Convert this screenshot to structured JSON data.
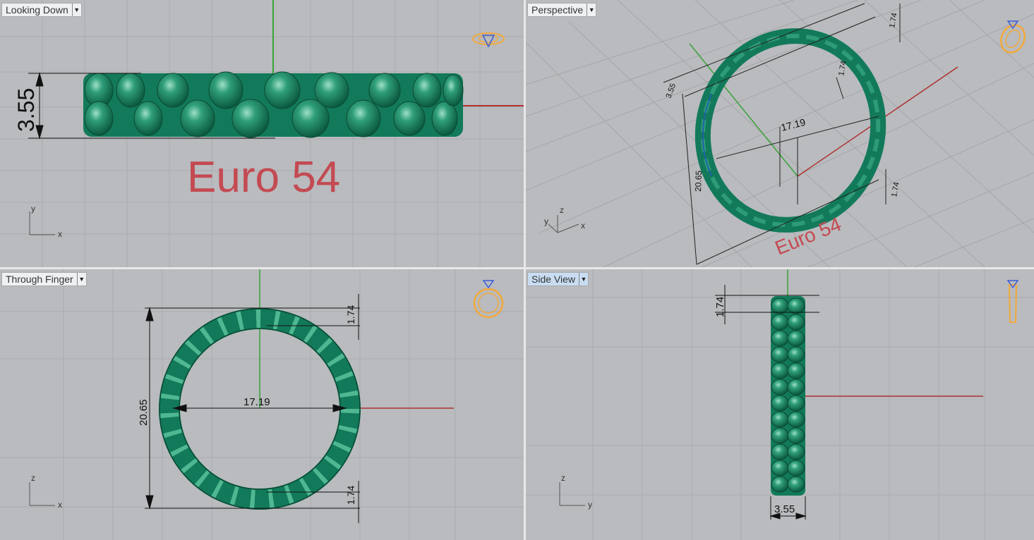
{
  "viewports": {
    "top": {
      "label": "Looking Down",
      "dim_height": "3.55",
      "title": "Euro 54",
      "axis_v": "y",
      "axis_h": "x"
    },
    "perspective": {
      "label": "Perspective",
      "dim_diameter": "17.19",
      "dim_outer": "20.65",
      "dim_small_a": "1.74",
      "dim_small_b": "1.74",
      "dim_small_c": "1.74",
      "dim_small_d": "3.55",
      "title": "Euro 54",
      "axis_y": "y",
      "axis_z": "z",
      "axis_x": "x"
    },
    "front": {
      "label": "Through Finger",
      "dim_inner": "17.19",
      "dim_outer": "20.65",
      "dim_top": "1.74",
      "dim_bottom": "1.74",
      "axis_v": "z",
      "axis_h": "x"
    },
    "right": {
      "label": "Side View",
      "dim_top": "1.74",
      "dim_width": "3.55",
      "axis_v": "z",
      "axis_h": "y"
    }
  },
  "colors": {
    "viewport_bg": "#b9bbbe",
    "gem_green": "#127a5a",
    "axis_red": "#b03030",
    "axis_green": "#3aa23a",
    "icon_orange": "#f2a93b",
    "icon_blue": "#3b5bd8"
  }
}
